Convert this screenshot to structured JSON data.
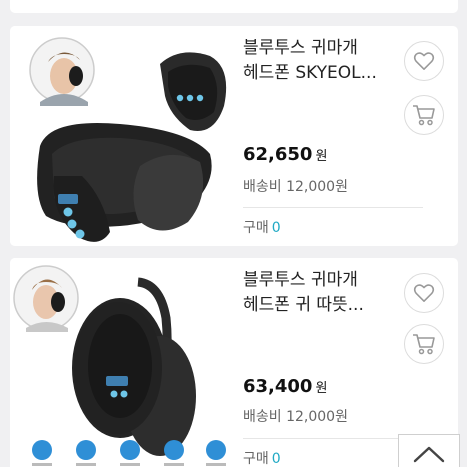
{
  "products": [
    {
      "title_line1": "블루투스 귀마개",
      "title_line2": "헤드폰 SKYEOL...",
      "price": "62,650",
      "price_unit": "원",
      "shipping": "배송비 12,000원",
      "buy_label": "구매",
      "buy_count": "0",
      "product_label": "Bluetooth Earmuff"
    },
    {
      "title_line1": "블루투스 귀마개",
      "title_line2": "헤드폰 귀 따뜻...",
      "price": "63,400",
      "price_unit": "원",
      "shipping": "배송비 12,000원",
      "buy_label": "구매",
      "buy_count": "0",
      "product_label": "Bluetooth Earmuff"
    }
  ],
  "icons": {
    "like": "heart-icon",
    "cart": "cart-icon",
    "scroll_top": "chevron-up-icon"
  },
  "colors": {
    "accent_count": "#1fa9c4",
    "background": "#f0f0f2",
    "button_icon": "#999999"
  }
}
